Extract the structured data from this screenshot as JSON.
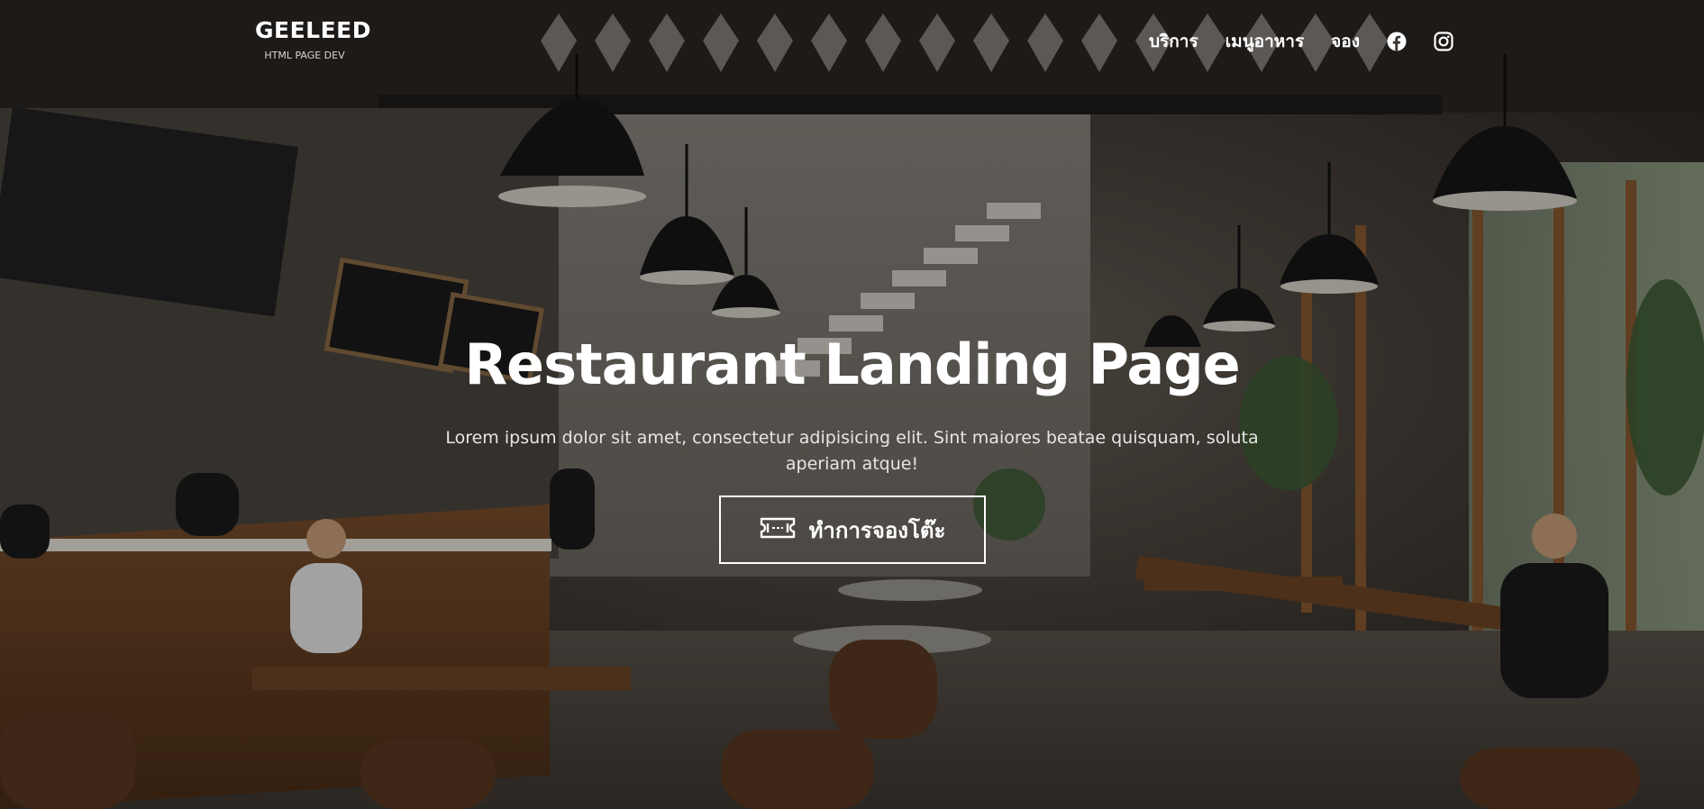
{
  "brand": {
    "name": "GEELEED",
    "subtitle": "HTML PAGE DEV"
  },
  "nav": {
    "items": [
      {
        "label": "บริการ"
      },
      {
        "label": "เมนูอาหาร"
      },
      {
        "label": "จอง"
      }
    ],
    "icons": [
      "facebook-icon",
      "instagram-icon"
    ]
  },
  "hero": {
    "title": "Restaurant Landing Page",
    "description": "Lorem ipsum dolor sit amet, consectetur adipisicing elit. Sint maiores beatae quisquam, soluta aperiam atque!",
    "cta_label": "ทำการจองโต๊ะ",
    "cta_icon": "ticket-icon"
  },
  "colors": {
    "text": "#ffffff",
    "overlay": "#000000"
  }
}
